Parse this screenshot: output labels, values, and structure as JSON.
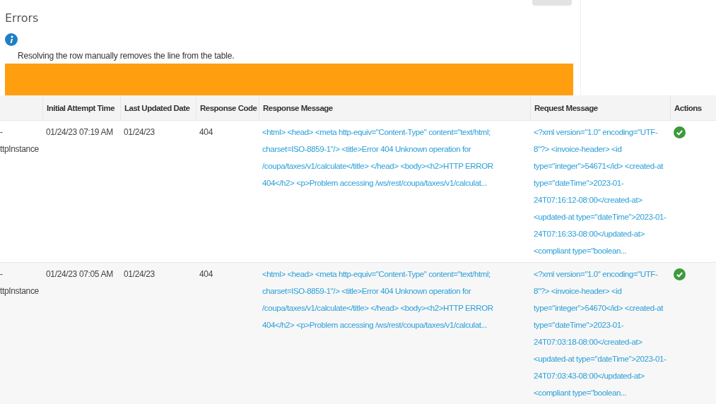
{
  "page": {
    "title": "Errors",
    "info_text": "Resolving the row manually removes the line from the table."
  },
  "table": {
    "columns": [
      "Initial Attempt Time",
      "Last Updated Date",
      "Response Code",
      "Response Message",
      "Request Message",
      "Actions"
    ],
    "rows": [
      {
        "column_1": [
          "-",
          "ttpInstance"
        ],
        "initial_attempt_time": "01/24/23 07:19 AM",
        "last_updated_date": "01/24/23",
        "response_code": "404",
        "response_message": "<html> <head> <meta http-equiv=\"Content-Type\" content=\"text/html; charset=ISO-8859-1\"/> <title>Error 404 Unknown operation for /coupa/taxes/v1/calculate</title> </head> <body><h2>HTTP ERROR 404</h2> <p>Problem accessing /ws/rest/coupa/taxes/v1/calculat...",
        "request_message": "<?xml version=\"1.0\" encoding=\"UTF-8\"?> <invoice-header> <id type=\"integer\">54671</id> <created-at type=\"dateTime\">2023-01-24T07:16:12-08:00</created-at> <updated-at type=\"dateTime\">2023-01-24T07:16:33-08:00</updated-at> <compliant type=\"boolean..."
      },
      {
        "column_1": [
          "-",
          "ttpInstance"
        ],
        "initial_attempt_time": "01/24/23 07:05 AM",
        "last_updated_date": "01/24/23",
        "response_code": "404",
        "response_message": "<html> <head> <meta http-equiv=\"Content-Type\" content=\"text/html; charset=ISO-8859-1\"/> <title>Error 404 Unknown operation for /coupa/taxes/v1/calculate</title> </head> <body><h2>HTTP ERROR 404</h2> <p>Problem accessing /ws/rest/coupa/taxes/v1/calculat...",
        "request_message": "<?xml version=\"1.0\" encoding=\"UTF-8\"?> <invoice-header> <id type=\"integer\">54670</id> <created-at type=\"dateTime\">2023-01-24T07:03:18-08:00</created-at> <updated-at type=\"dateTime\">2023-01-24T07:03:43-08:00</updated-at> <compliant type=\"boolean..."
      }
    ]
  }
}
